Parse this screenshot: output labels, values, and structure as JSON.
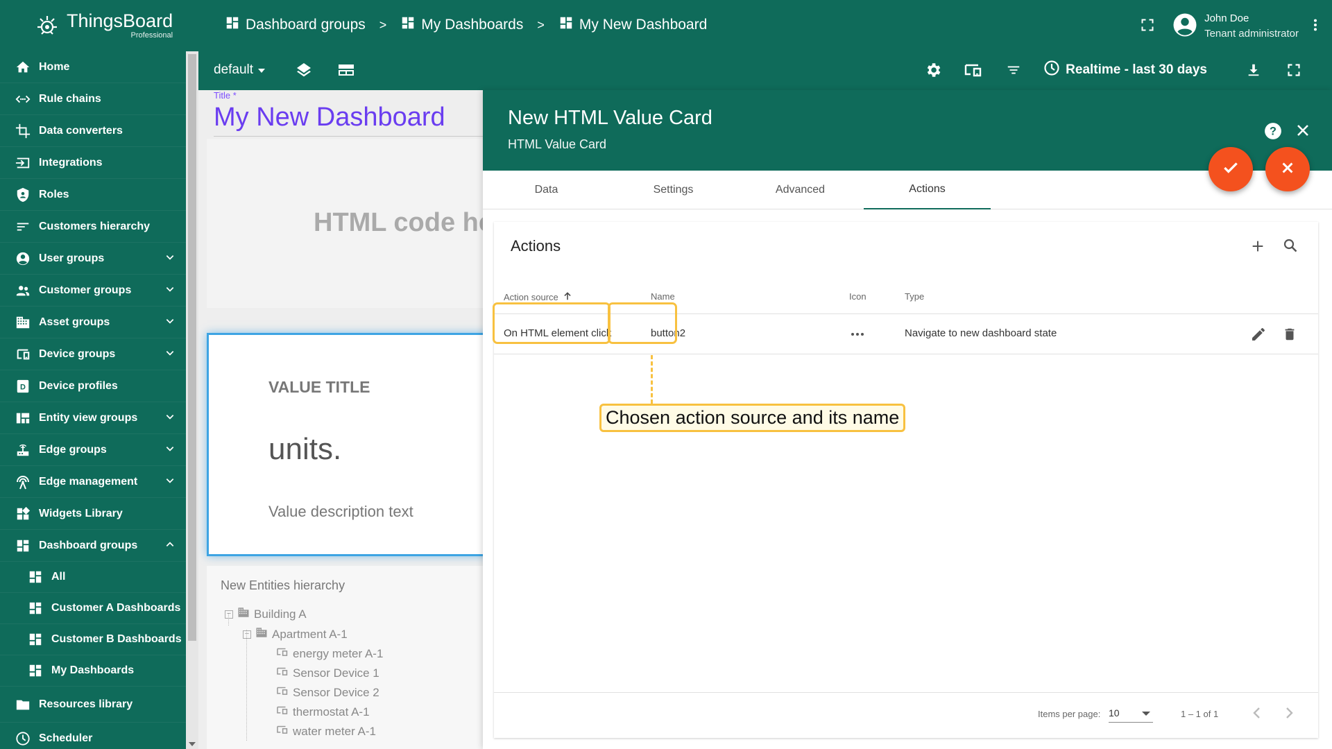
{
  "app": {
    "logo_name": "ThingsBoard",
    "logo_sub": "Professional",
    "brand_color": "#0f6b5a",
    "accent_color": "#f4511e",
    "highlight_color": "#f8c140"
  },
  "sidebar": {
    "items": [
      {
        "label": "Home",
        "icon": "home-icon"
      },
      {
        "label": "Rule chains",
        "icon": "code-arrows-icon"
      },
      {
        "label": "Data converters",
        "icon": "crop-icon"
      },
      {
        "label": "Integrations",
        "icon": "input-icon"
      },
      {
        "label": "Roles",
        "icon": "shield-icon"
      },
      {
        "label": "Customers hierarchy",
        "icon": "sort-icon"
      },
      {
        "label": "User groups",
        "icon": "account-circle-icon"
      },
      {
        "label": "Customer groups",
        "icon": "supervisor-icon"
      },
      {
        "label": "Asset groups",
        "icon": "domain-icon"
      },
      {
        "label": "Device groups",
        "icon": "devices-icon"
      },
      {
        "label": "Device profiles",
        "icon": "device-profile-icon"
      },
      {
        "label": "Entity view groups",
        "icon": "view-quilt-icon"
      },
      {
        "label": "Edge groups",
        "icon": "router-icon"
      },
      {
        "label": "Edge management",
        "icon": "settings-input-antenna-icon"
      },
      {
        "label": "Widgets Library",
        "icon": "widgets-icon"
      },
      {
        "label": "Dashboard groups",
        "icon": "dashboard-icon"
      }
    ],
    "sub_items": [
      {
        "label": "All"
      },
      {
        "label": "Customer A Dashboards"
      },
      {
        "label": "Customer B Dashboards"
      },
      {
        "label": "My Dashboards"
      }
    ],
    "bottom_items": [
      {
        "label": "Resources library",
        "icon": "folder-icon"
      },
      {
        "label": "Scheduler",
        "icon": "schedule-icon"
      }
    ]
  },
  "header": {
    "breadcrumbs": [
      {
        "label": "Dashboard groups"
      },
      {
        "label": "My Dashboards"
      },
      {
        "label": "My New Dashboard"
      }
    ],
    "separator": ">",
    "user_name": "John Doe",
    "user_role": "Tenant administrator"
  },
  "toolbar": {
    "state": "default",
    "timewindow": "Realtime - last 30 days"
  },
  "dashboard": {
    "title_label": "Title *",
    "title": "My New Dashboard",
    "html_widget_text": "HTML code here",
    "value_card": {
      "title": "VALUE TITLE",
      "units": "units.",
      "description": "Value description text"
    },
    "hierarchy": {
      "title": "New Entities hierarchy",
      "nodes": [
        {
          "label": "Building A"
        },
        {
          "label": "Apartment A-1"
        },
        {
          "label": "energy meter A-1"
        },
        {
          "label": "Sensor Device 1"
        },
        {
          "label": "Sensor Device 2"
        },
        {
          "label": "thermostat A-1"
        },
        {
          "label": "water meter A-1"
        }
      ]
    }
  },
  "editor": {
    "title": "New HTML Value Card",
    "subtitle": "HTML Value Card",
    "tabs": [
      {
        "label": "Data"
      },
      {
        "label": "Settings"
      },
      {
        "label": "Advanced"
      },
      {
        "label": "Actions"
      }
    ],
    "active_tab": "Actions",
    "actions": {
      "title": "Actions",
      "columns": {
        "source": "Action source",
        "name": "Name",
        "icon": "Icon",
        "type": "Type"
      },
      "rows": [
        {
          "source": "On HTML element click",
          "name": "button2",
          "icon": "more-horiz-icon",
          "type": "Navigate to new dashboard state"
        }
      ],
      "callout": "Chosen action source and its name",
      "paginator": {
        "items_per_page_label": "Items per page:",
        "items_per_page": "10",
        "range": "1 – 1 of 1"
      }
    }
  }
}
